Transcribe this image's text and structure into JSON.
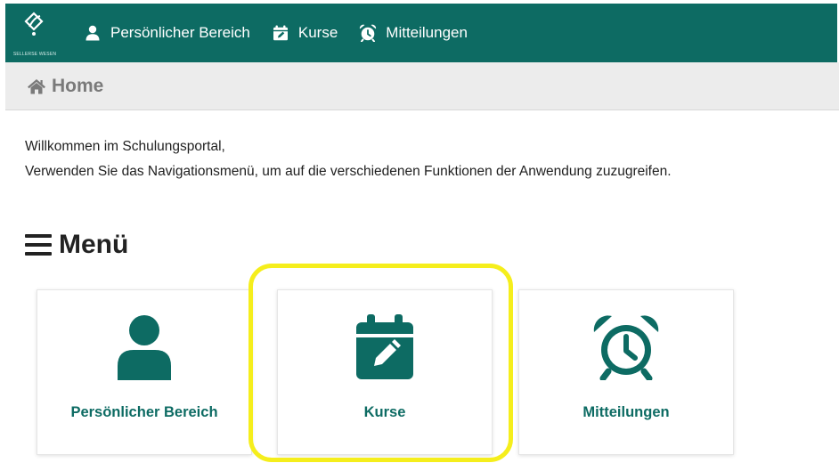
{
  "brand": {
    "logo_text": "SELLERSE WESEN"
  },
  "navbar": {
    "items": [
      {
        "label": "Persönlicher Bereich",
        "icon": "user-icon"
      },
      {
        "label": "Kurse",
        "icon": "calendar-edit-icon"
      },
      {
        "label": "Mitteilungen",
        "icon": "alarm-clock-icon"
      }
    ]
  },
  "breadcrumb": {
    "label": "Home",
    "icon": "home-icon"
  },
  "welcome": {
    "line1": "Willkommen im Schulungsportal,",
    "line2": "Verwenden Sie das Navigationsmenü, um auf die verschiedenen Funktionen der Anwendung zuzugreifen."
  },
  "menu": {
    "heading": "Menü",
    "heading_icon": "hamburger-icon",
    "cards": [
      {
        "label": "Persönlicher Bereich",
        "icon": "user-icon"
      },
      {
        "label": "Kurse",
        "icon": "calendar-edit-icon"
      },
      {
        "label": "Mitteilungen",
        "icon": "alarm-clock-icon"
      }
    ]
  },
  "colors": {
    "brand": "#0d6b63",
    "breadcrumb_bg": "#ececec",
    "highlight": "#f5ee1c"
  }
}
